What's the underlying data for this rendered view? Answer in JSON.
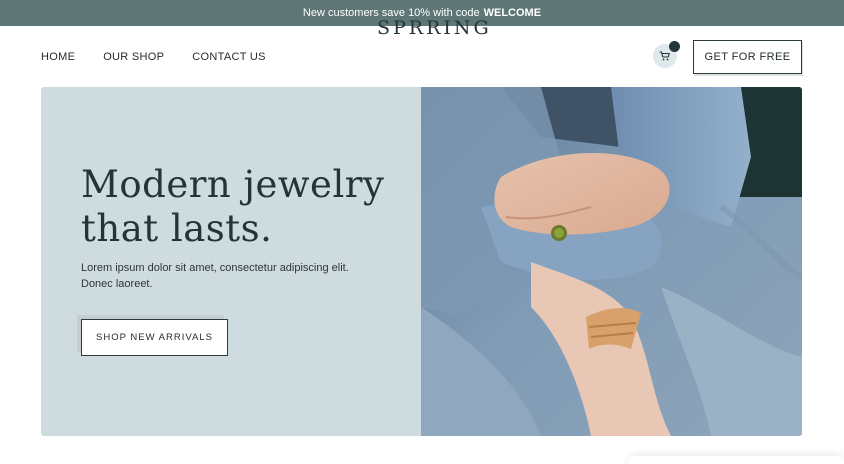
{
  "announcement": {
    "text": "New customers save 10% with code",
    "code": "WELCOME"
  },
  "nav": {
    "links": [
      "HOME",
      "OUR SHOP",
      "CONTACT US"
    ],
    "logo": "SPRRING",
    "cta_label": "GET FOR FREE"
  },
  "cart": {
    "icon": "cart-icon"
  },
  "hero": {
    "title_line1": "Modern jewelry",
    "title_line2": "that lasts.",
    "copy": "Lorem ipsum dolor sit amet, consectetur adipiscing elit. Donec laoreet.",
    "button_label": "SHOP NEW ARRIVALS"
  },
  "colors": {
    "announcement_bg": "#5f7676",
    "hero_panel": "#cfdcdf",
    "accent_dark": "#253636"
  }
}
